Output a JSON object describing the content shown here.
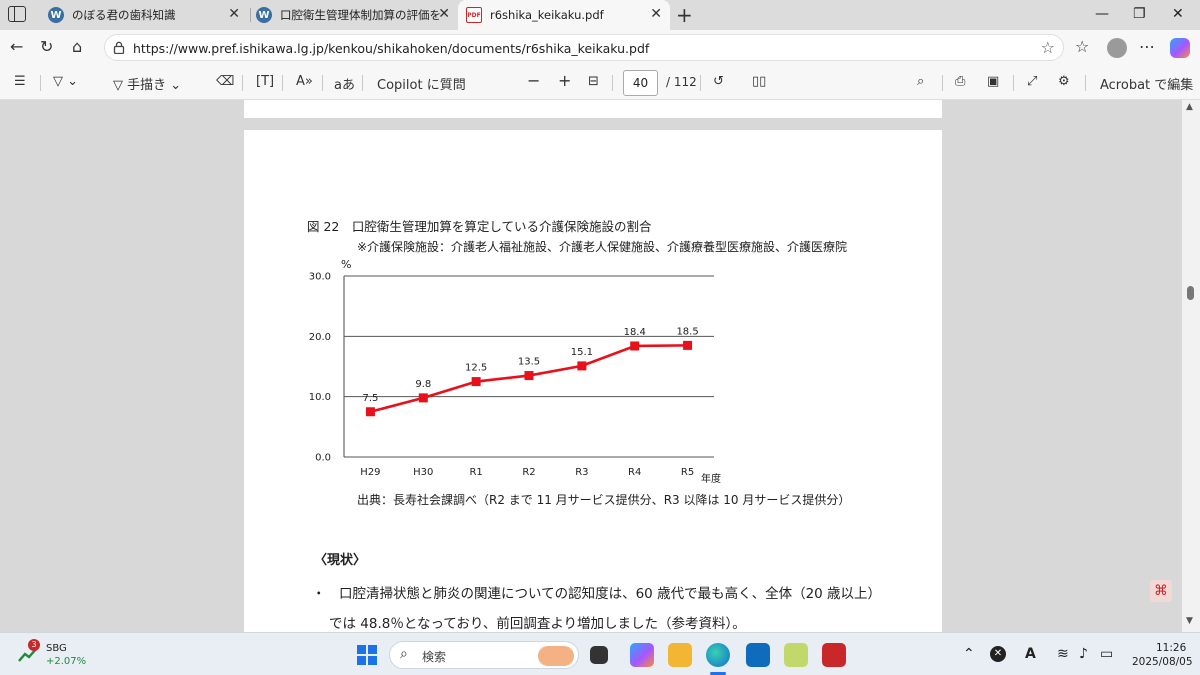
{
  "tabs": [
    {
      "title": "のぼる君の歯科知識",
      "favicon": "W"
    },
    {
      "title": "口腔衛生管理体制加算の評価を廃",
      "favicon": "W"
    },
    {
      "title": "r6shika_keikaku.pdf",
      "favicon": "PDF"
    }
  ],
  "address": {
    "url": "https://www.pref.ishikawa.lg.jp/kenkou/shikahoken/documents/r6shika_keikaku.pdf"
  },
  "pdf_toolbar": {
    "draw_label": "手描き",
    "copilot_label": "Copilot に質問",
    "page_current": "40",
    "page_total": "/ 112",
    "acrobat_label": "Acrobat で編集",
    "text_size_label": "aあ"
  },
  "document": {
    "figure_title": "図 22　口腔衛生管理加算を算定している介護保険施設の割合",
    "figure_note": "※介護保険施設：介護老人福祉施設、介護老人保健施設、介護療養型医療施設、介護医療院",
    "source_text": "出典：長寿社会課調べ（R2 まで 11 月サービス提供分、R3 以降は 10 月サービス提供分）",
    "section_heading": "〈現状〉",
    "bullet_1": "・　口腔清掃状態と肺炎の関連についての認知度は、60 歳代で最も高く、全体（20 歳以上）",
    "bullet_1_cont": "では 48.8％となっており、前回調査より増加しました（参考資料）。"
  },
  "chart_data": {
    "type": "line",
    "title": "",
    "xlabel": "年度",
    "ylabel": "%",
    "ylim": [
      0,
      30
    ],
    "yticks": [
      "0.0",
      "10.0",
      "20.0",
      "30.0"
    ],
    "categories": [
      "H29",
      "H30",
      "R1",
      "R2",
      "R3",
      "R4",
      "R5"
    ],
    "series": [
      {
        "values": [
          7.5,
          9.8,
          12.5,
          13.5,
          15.1,
          18.4,
          18.5
        ],
        "color": "#e8101a"
      }
    ],
    "data_labels": [
      "7.5",
      "9.8",
      "12.5",
      "13.5",
      "15.1",
      "18.4",
      "18.5"
    ],
    "grid": true
  },
  "taskbar": {
    "stock_badge": "3",
    "stock_name": "SBG",
    "stock_change": "+2.07%",
    "search_placeholder": "検索",
    "time": "11:26",
    "date": "2025/08/05"
  }
}
